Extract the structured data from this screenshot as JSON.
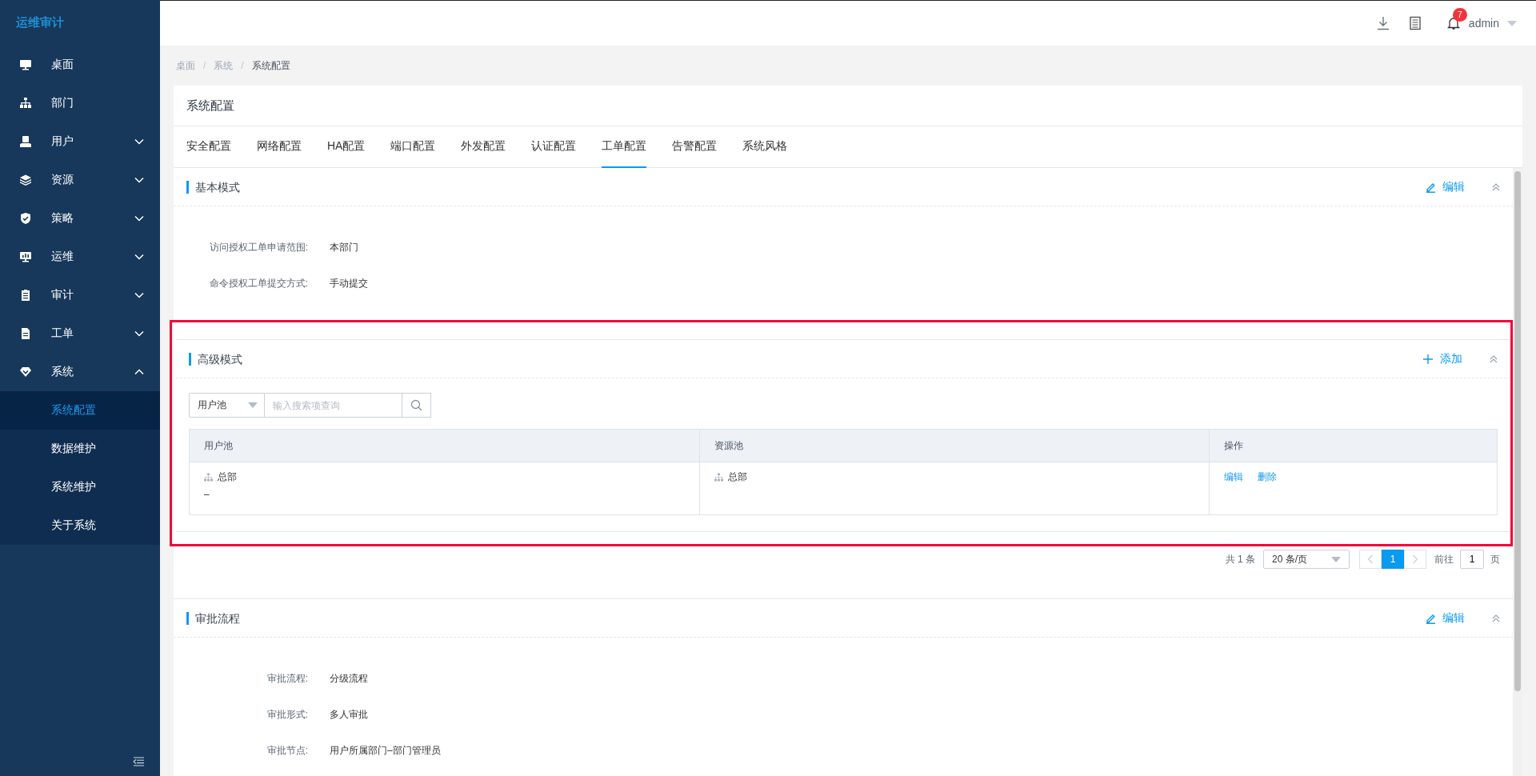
{
  "sidebar": {
    "logo": "运维审计",
    "items": [
      {
        "label": "桌面",
        "kind": "monitor"
      },
      {
        "label": "部门",
        "kind": "org"
      },
      {
        "label": "用户",
        "kind": "user",
        "expanded": false
      },
      {
        "label": "资源",
        "kind": "layers",
        "expanded": false
      },
      {
        "label": "策略",
        "kind": "shield",
        "expanded": false
      },
      {
        "label": "运维",
        "kind": "dashboard",
        "expanded": false
      },
      {
        "label": "审计",
        "kind": "clipboard",
        "expanded": false
      },
      {
        "label": "工单",
        "kind": "document",
        "expanded": false
      },
      {
        "label": "系统",
        "kind": "diamond",
        "expanded": true,
        "children": [
          {
            "label": "系统配置",
            "selected": true
          },
          {
            "label": "数据维护",
            "selected": false
          },
          {
            "label": "系统维护",
            "selected": false
          },
          {
            "label": "关于系统",
            "selected": false
          }
        ]
      }
    ]
  },
  "top_bar": {
    "notification_count": "7",
    "user": "admin"
  },
  "breadcrumb": {
    "separator": "/",
    "items": [
      "桌面",
      "系统",
      "系统配置"
    ]
  },
  "card": {
    "title": "系统配置",
    "tabs": [
      {
        "label": "安全配置",
        "selected": false
      },
      {
        "label": "网络配置",
        "selected": false
      },
      {
        "label": "HA配置",
        "selected": false
      },
      {
        "label": "端口配置",
        "selected": false
      },
      {
        "label": "外发配置",
        "selected": false
      },
      {
        "label": "认证配置",
        "selected": false
      },
      {
        "label": "工单配置",
        "selected": true
      },
      {
        "label": "告警配置",
        "selected": false
      },
      {
        "label": "系统风格",
        "selected": false
      }
    ],
    "sections": [
      {
        "kind": "fields",
        "title": "基本模式",
        "action": {
          "kind": "edit",
          "label": "编辑"
        },
        "fields": [
          {
            "label": "访问授权工单申请范围:",
            "value": "本部门"
          },
          {
            "label": "命令授权工单提交方式:",
            "value": "手动提交"
          }
        ]
      },
      {
        "kind": "table",
        "title": "高级模式",
        "highlighted": true,
        "action": {
          "kind": "add",
          "label": "添加"
        },
        "search": {
          "filter": "用户池",
          "placeholder": "输入搜索项查询"
        },
        "table": {
          "columns": [
            "用户池",
            "资源池",
            "操作"
          ],
          "rows": [
            {
              "user_pool": {
                "name": "总部",
                "note": "–"
              },
              "resource_pool": {
                "name": "总部"
              },
              "actions": [
                "编辑",
                "删除"
              ]
            }
          ]
        },
        "pagination": {
          "total": "共 1 条",
          "page_size": "20 条/页",
          "pages": [
            {
              "label": "1",
              "selected": true
            }
          ],
          "goto_label": "前往",
          "goto_value": "1",
          "page_suffix": "页"
        }
      },
      {
        "kind": "fields",
        "title": "审批流程",
        "action": {
          "kind": "edit",
          "label": "编辑"
        },
        "fields": [
          {
            "label": "审批流程:",
            "value": "分级流程"
          },
          {
            "label": "审批形式:",
            "value": "多人审批"
          },
          {
            "label": "审批节点:",
            "value": "用户所属部门–部门管理员"
          }
        ]
      }
    ]
  }
}
